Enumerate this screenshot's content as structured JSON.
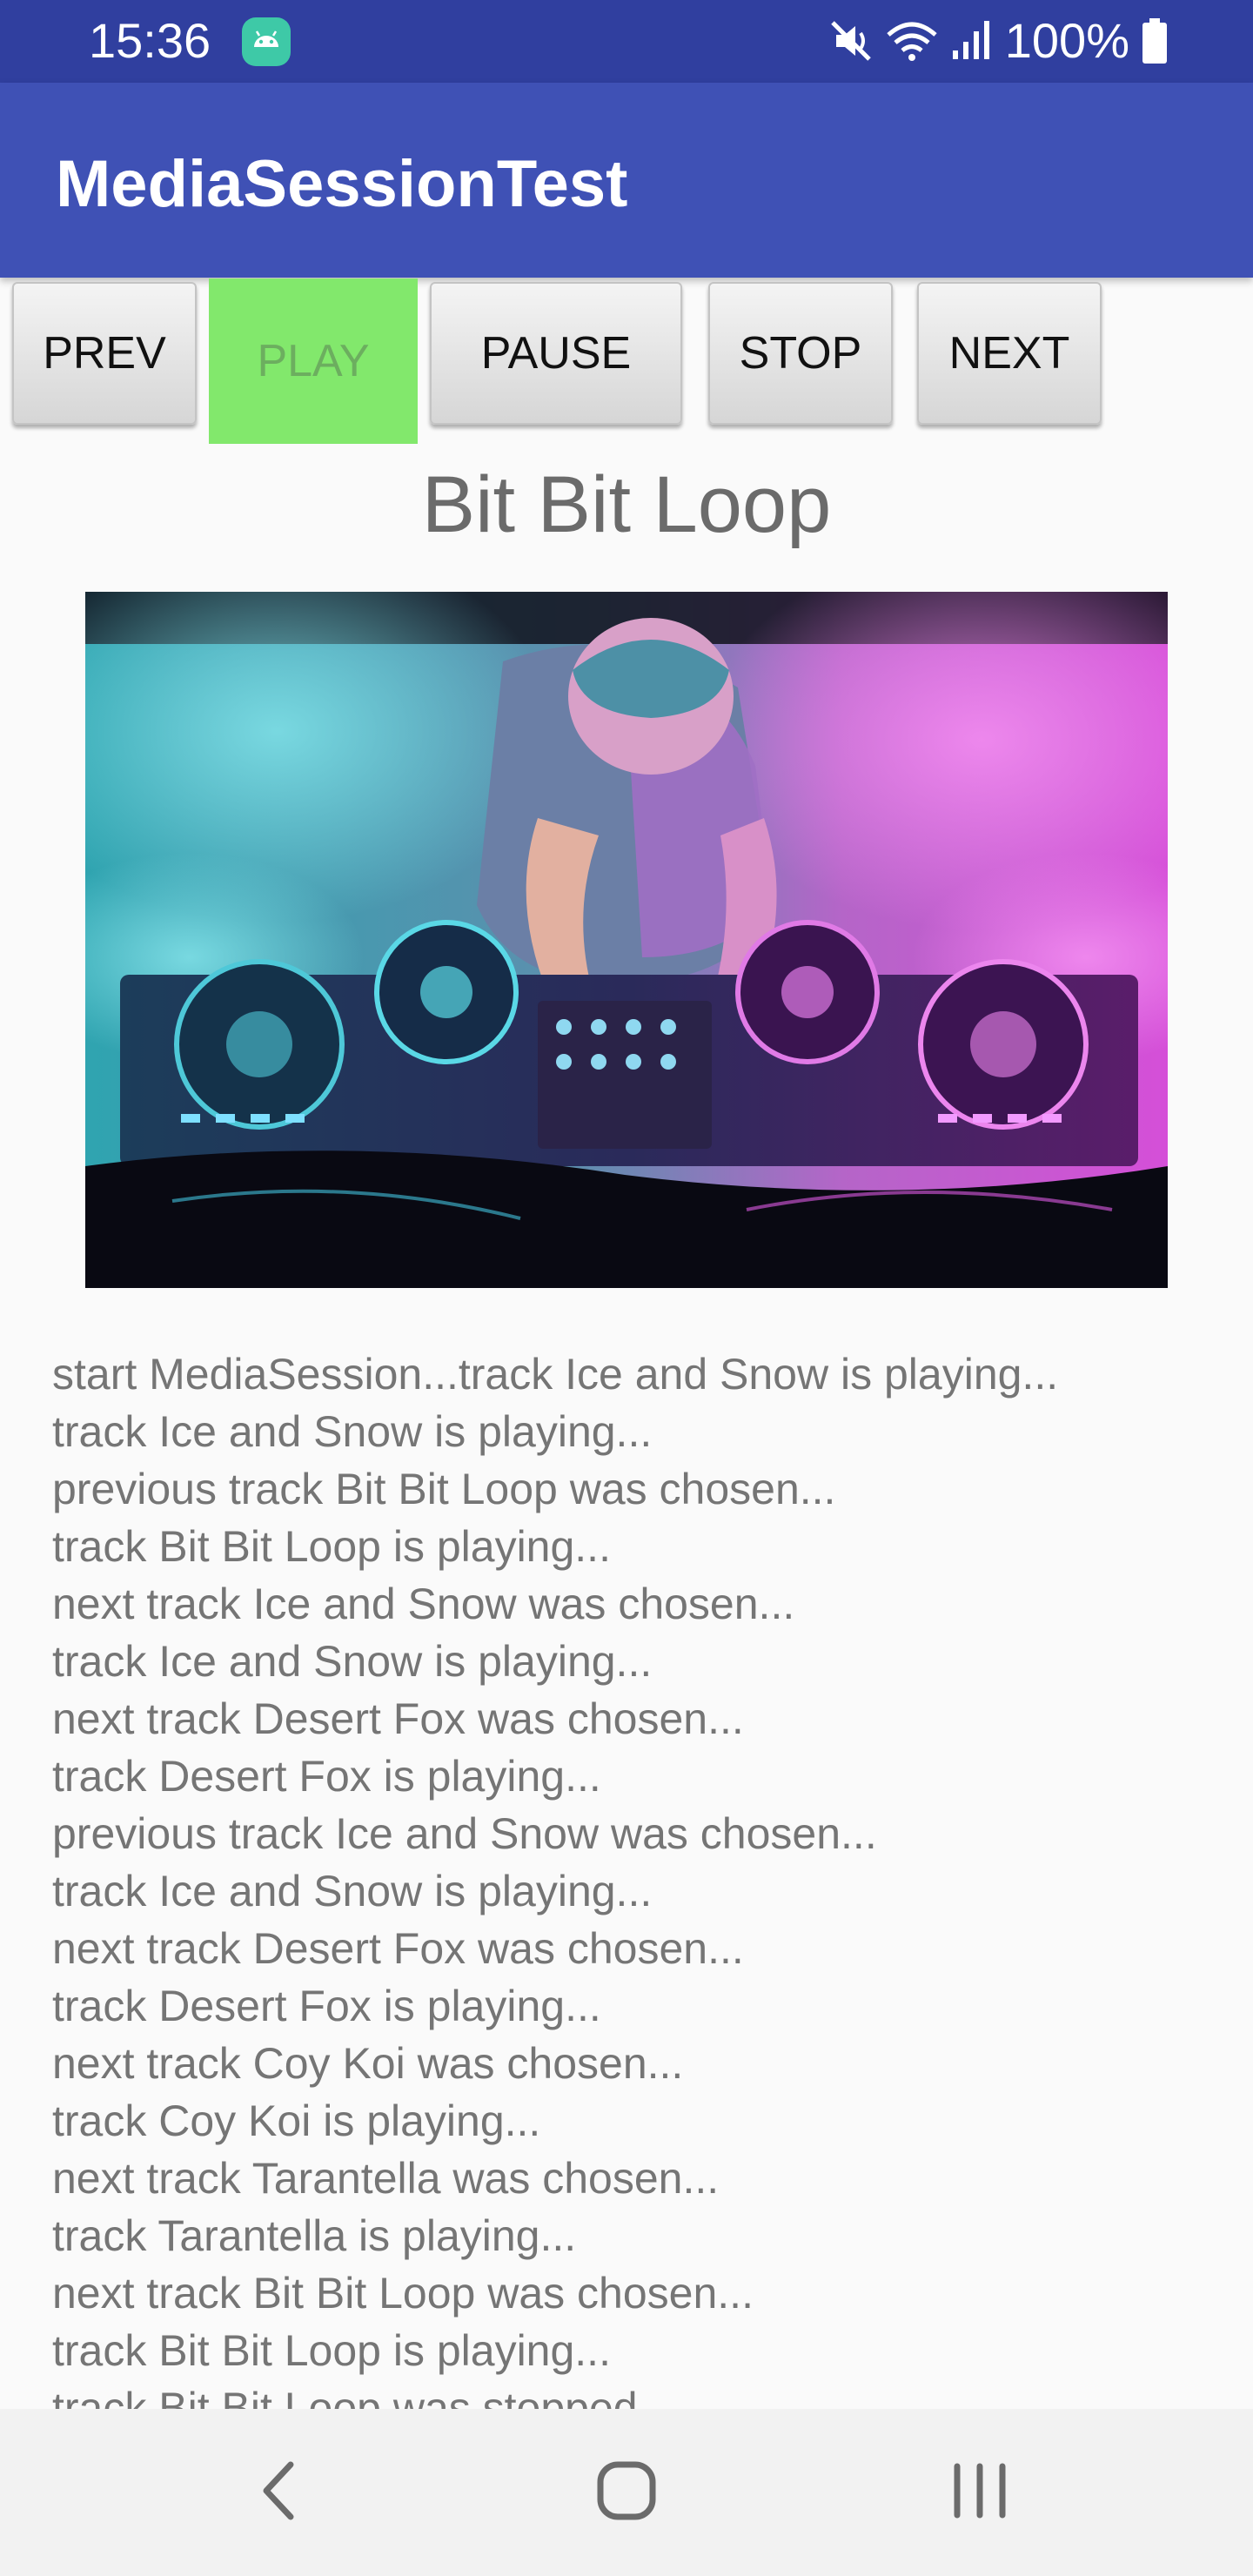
{
  "status_bar": {
    "time": "15:36",
    "notification_icon": "android-icon",
    "icons": [
      "muted-icon",
      "wifi-icon",
      "signal-icon",
      "battery-icon"
    ],
    "battery_percent": "100%",
    "background_color": "#303f9f"
  },
  "app_bar": {
    "title": "MediaSessionTest",
    "background_color": "#3f51b5"
  },
  "controls": {
    "prev_label": "PREV",
    "play_label": "PLAY",
    "pause_label": "PAUSE",
    "stop_label": "STOP",
    "next_label": "NEXT",
    "active_button": "PLAY",
    "active_color": "#82e86c"
  },
  "now_playing": {
    "title": "Bit Bit Loop",
    "album_art": "dj-mixing-photo"
  },
  "log": [
    "start MediaSession...track Ice and Snow is playing...",
    "track Ice and Snow is playing...",
    "previous track Bit Bit Loop was chosen...",
    "track Bit Bit Loop is playing...",
    "next track Ice and Snow was chosen...",
    "track Ice and Snow is playing...",
    "next track Desert Fox was chosen...",
    "track Desert Fox is playing...",
    "previous track Ice and Snow was chosen...",
    "track Ice and Snow is playing...",
    "next track Desert Fox was chosen...",
    "track Desert Fox is playing...",
    "next track Coy Koi was chosen...",
    "track Coy Koi is playing...",
    "next track Tarantella was chosen...",
    "track Tarantella is playing...",
    "next track Bit Bit Loop was chosen...",
    "track Bit Bit Loop is playing...",
    "track Bit Bit Loop was stopped..."
  ],
  "nav_bar": {
    "buttons": [
      "back-icon",
      "home-icon",
      "recents-icon"
    ]
  }
}
